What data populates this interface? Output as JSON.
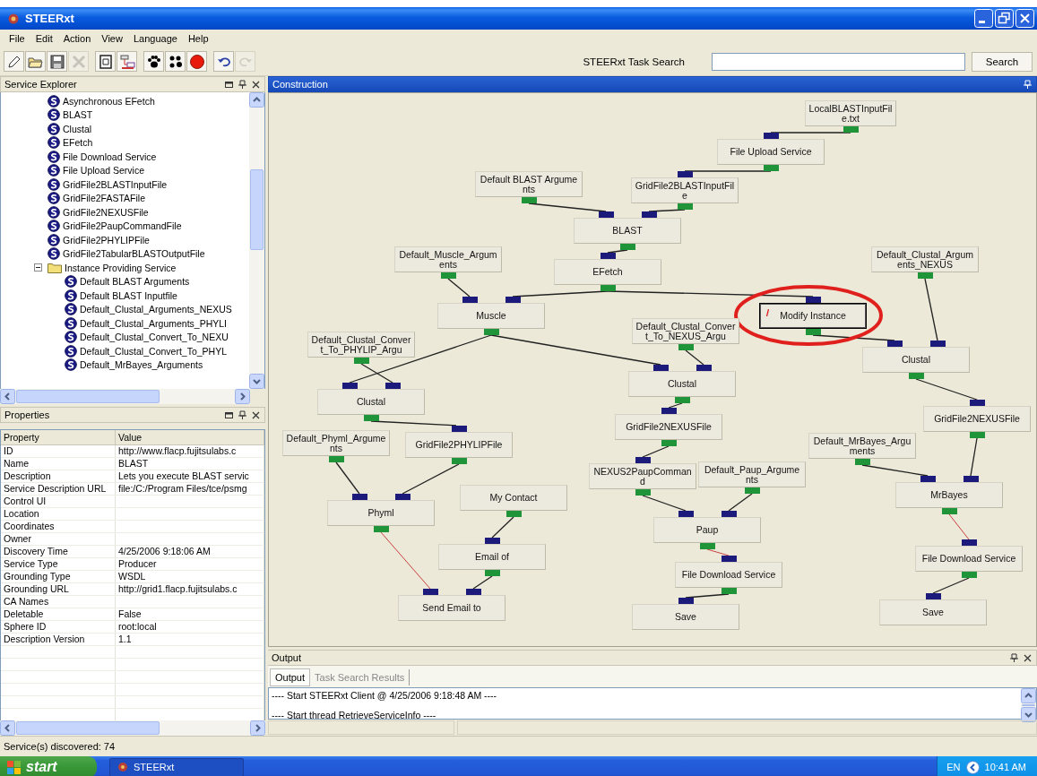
{
  "window": {
    "title": "STEERxt"
  },
  "menu": [
    "File",
    "Edit",
    "Action",
    "View",
    "Language",
    "Help"
  ],
  "toolbar": [
    {
      "kind": "pencil",
      "disabled": false
    },
    {
      "kind": "folder",
      "disabled": false
    },
    {
      "kind": "disk",
      "disabled": false
    },
    {
      "kind": "delete",
      "disabled": true
    },
    {
      "kind": "document",
      "disabled": false
    },
    {
      "kind": "diagram",
      "disabled": false
    },
    {
      "kind": "paw",
      "disabled": false
    },
    {
      "kind": "paws",
      "disabled": false
    },
    {
      "kind": "stop",
      "disabled": false
    },
    {
      "kind": "undo",
      "disabled": false
    },
    {
      "kind": "redo",
      "disabled": true
    }
  ],
  "task_search": {
    "label": "STEERxt Task Search",
    "button": "Search"
  },
  "service_explorer": {
    "title": "Service Explorer",
    "tree": [
      {
        "label": "Asynchronous EFetch",
        "kind": "service"
      },
      {
        "label": "BLAST",
        "kind": "service"
      },
      {
        "label": "Clustal",
        "kind": "service"
      },
      {
        "label": "EFetch",
        "kind": "service"
      },
      {
        "label": "File Download Service",
        "kind": "service"
      },
      {
        "label": "File Upload Service",
        "kind": "service"
      },
      {
        "label": "GridFile2BLASTInputFile",
        "kind": "service"
      },
      {
        "label": "GridFile2FASTAFile",
        "kind": "service"
      },
      {
        "label": "GridFile2NEXUSFile",
        "kind": "service"
      },
      {
        "label": "GridFile2PaupCommandFile",
        "kind": "service"
      },
      {
        "label": "GridFile2PHYLIPFile",
        "kind": "service"
      },
      {
        "label": "GridFile2TabularBLASTOutputFile",
        "kind": "service"
      },
      {
        "label": "Instance Providing Service",
        "kind": "folder",
        "expanded": true,
        "children": [
          {
            "label": "Default BLAST Arguments",
            "kind": "service"
          },
          {
            "label": "Default BLAST Inputfile",
            "kind": "service"
          },
          {
            "label": "Default_Clustal_Arguments_NEXUS",
            "kind": "service"
          },
          {
            "label": "Default_Clustal_Arguments_PHYLI",
            "kind": "service"
          },
          {
            "label": "Default_Clustal_Convert_To_NEXU",
            "kind": "service"
          },
          {
            "label": "Default_Clustal_Convert_To_PHYL",
            "kind": "service"
          },
          {
            "label": "Default_MrBayes_Arguments",
            "kind": "service"
          }
        ]
      }
    ]
  },
  "properties": {
    "title": "Properties",
    "columns": [
      "Property",
      "Value"
    ],
    "rows": [
      {
        "property": "ID",
        "value": "http://www.flacp.fujitsulabs.c"
      },
      {
        "property": "Name",
        "value": "BLAST"
      },
      {
        "property": "Description",
        "value": "Lets you execute BLAST servic"
      },
      {
        "property": "Service Description URL",
        "value": "file:/C:/Program Files/tce/psmg"
      },
      {
        "property": "Control UI",
        "value": ""
      },
      {
        "property": "Location",
        "value": ""
      },
      {
        "property": "Coordinates",
        "value": ""
      },
      {
        "property": "Owner",
        "value": ""
      },
      {
        "property": "Discovery Time",
        "value": "4/25/2006 9:18:06 AM"
      },
      {
        "property": "Service Type",
        "value": "Producer"
      },
      {
        "property": "Grounding Type",
        "value": "WSDL"
      },
      {
        "property": "Grounding URL",
        "value": "http://grid1.flacp.fujitsulabs.c"
      },
      {
        "property": "CA Names",
        "value": ""
      },
      {
        "property": "Deletable",
        "value": "False"
      },
      {
        "property": "Sphere ID",
        "value": "root:local"
      },
      {
        "property": "Description Version",
        "value": "1.1"
      }
    ]
  },
  "construction": {
    "title": "Construction",
    "nodes": [
      {
        "label": "LocalBLASTInputFile.txt",
        "selected": false,
        "circled": false
      },
      {
        "label": "File Upload Service",
        "selected": false,
        "circled": false
      },
      {
        "label": "Default BLAST Arguments",
        "selected": false,
        "circled": false
      },
      {
        "label": "GridFile2BLASTInputFile",
        "selected": false,
        "circled": false
      },
      {
        "label": "BLAST",
        "selected": false,
        "circled": false
      },
      {
        "label": "Default_Muscle_Arguments",
        "selected": false,
        "circled": false
      },
      {
        "label": "EFetch",
        "selected": false,
        "circled": false
      },
      {
        "label": "Default_Clustal_Arguments_NEXUS",
        "selected": false,
        "circled": false
      },
      {
        "label": "Muscle",
        "selected": false,
        "circled": false
      },
      {
        "label": "Modify Instance",
        "selected": true,
        "circled": true
      },
      {
        "label": "Default_Clustal_Convert_To_NEXUS_Argu",
        "selected": false,
        "circled": false
      },
      {
        "label": "Default_Clustal_Convert_To_PHYLIP_Argu",
        "selected": false,
        "circled": false
      },
      {
        "label": "Clustal",
        "selected": false,
        "circled": false
      },
      {
        "label": "Clustal",
        "selected": false,
        "circled": false
      },
      {
        "label": "Clustal",
        "selected": false,
        "circled": false
      },
      {
        "label": "GridFile2NEXUSFile",
        "selected": false,
        "circled": false
      },
      {
        "label": "GridFile2NEXUSFile",
        "selected": false,
        "circled": false
      },
      {
        "label": "Default_Phyml_Arguments",
        "selected": false,
        "circled": false
      },
      {
        "label": "GridFile2PHYLIPFile",
        "selected": false,
        "circled": false
      },
      {
        "label": "Default_MrBayes_Arguments",
        "selected": false,
        "circled": false
      },
      {
        "label": "NEXUS2PaupCommand",
        "selected": false,
        "circled": false
      },
      {
        "label": "Default_Paup_Arguments",
        "selected": false,
        "circled": false
      },
      {
        "label": "My Contact",
        "selected": false,
        "circled": false
      },
      {
        "label": "Phyml",
        "selected": false,
        "circled": false
      },
      {
        "label": "MrBayes",
        "selected": false,
        "circled": false
      },
      {
        "label": "Paup",
        "selected": false,
        "circled": false
      },
      {
        "label": "Email of",
        "selected": false,
        "circled": false
      },
      {
        "label": "File Download Service",
        "selected": false,
        "circled": false
      },
      {
        "label": "File Download Service",
        "selected": false,
        "circled": false
      },
      {
        "label": "Send Email to",
        "selected": false,
        "circled": false
      },
      {
        "label": "Save",
        "selected": false,
        "circled": false
      },
      {
        "label": "Save",
        "selected": false,
        "circled": false
      }
    ]
  },
  "output": {
    "title": "Output",
    "tabs": [
      {
        "label": "Output",
        "selected": true
      },
      {
        "label": "Task Search Results",
        "selected": false
      }
    ],
    "lines": [
      "---- Start STEERxt Client @ 4/25/2006 9:18:48 AM ----",
      "---- Start thread RetrieveServiceInfo ----"
    ]
  },
  "status_bar": "Service(s) discovered: 74",
  "taskbar": {
    "start": "start",
    "task": "STEERxt",
    "language": "EN",
    "clock": "10:41 AM"
  }
}
